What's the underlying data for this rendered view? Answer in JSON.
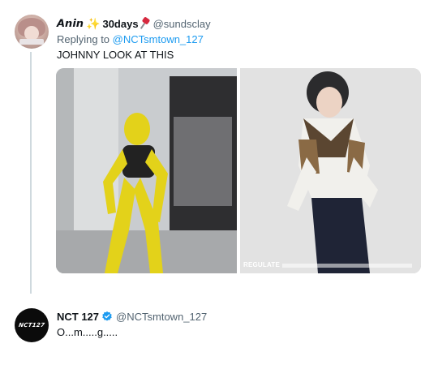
{
  "tweet_1": {
    "display_name": "𝘼𝙣𝙞𝙣",
    "name_suffix": "30days",
    "handle": "@sundsclay",
    "replying_prefix": "Replying to",
    "replying_to": "@NCTsmtown_127",
    "text": "JOHNNY LOOK AT THIS",
    "media_watermark": "REGULATE"
  },
  "tweet_2": {
    "avatar_logo": "NCT127",
    "display_name": "NCT 127",
    "handle": "@NCTsmtown_127",
    "text": "O...m.....g....."
  },
  "icons": {
    "sparkle": "sparkle-icon",
    "pin": "pushpin-icon",
    "verified": "verified-badge-icon"
  },
  "colors": {
    "link_blue": "#1d9bf0",
    "muted_text": "#536471",
    "thread_line": "#cfd9de"
  }
}
